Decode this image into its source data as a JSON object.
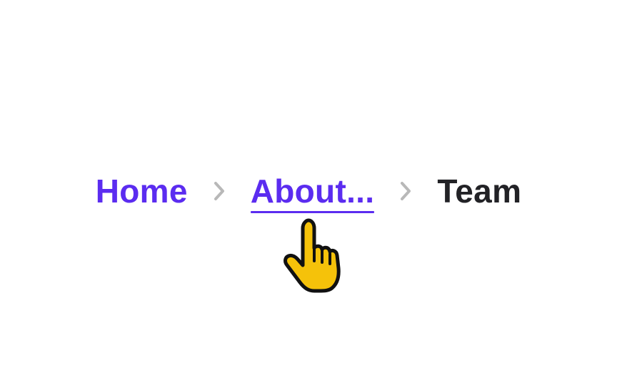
{
  "breadcrumb": {
    "items": [
      {
        "label": "Home",
        "state": "link"
      },
      {
        "label": "About...",
        "state": "link-hovered"
      },
      {
        "label": "Team",
        "state": "current"
      }
    ],
    "separator_icon": "chevron-right-icon"
  },
  "cursor": {
    "icon": "hand-pointer-icon",
    "color": "#f5c20a"
  },
  "colors": {
    "link": "#5b2cf0",
    "current": "#222226",
    "separator": "#b8b8b8",
    "background": "#ffffff"
  }
}
